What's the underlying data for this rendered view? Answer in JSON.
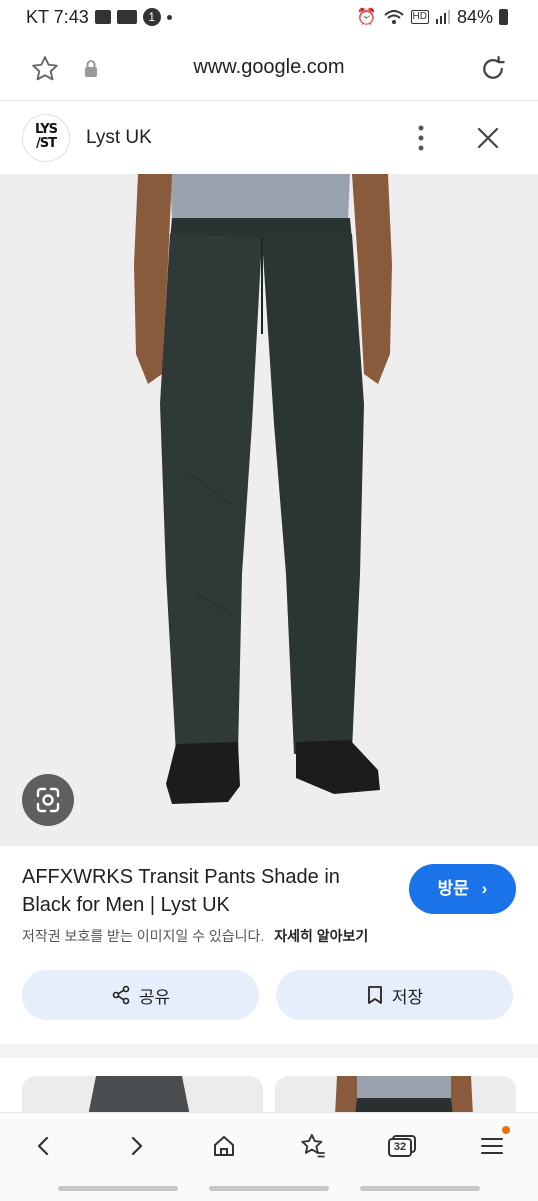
{
  "status_bar": {
    "carrier_time": "KT 7:43",
    "notif_badge": "1",
    "network": "HD",
    "battery": "84%"
  },
  "browser": {
    "url": "www.google.com"
  },
  "source": {
    "logo_text_line1": "LYS",
    "logo_text_line2": "/ST",
    "name": "Lyst UK"
  },
  "result": {
    "title": "AFFXWRKS Transit Pants Shade in Black for Men | Lyst UK",
    "visit_label": "방문",
    "copyright_note": "저작권 보호를 받는 이미지일 수 있습니다.",
    "learn_more": "자세히 알아보기",
    "share_label": "공유",
    "save_label": "저장"
  },
  "bottom_nav": {
    "tabs_count": "32"
  },
  "colors": {
    "accent": "#1a73e8",
    "pill_bg": "#e7eefb",
    "image_bg": "#eeeeee",
    "notification_dot": "#e8710a"
  }
}
